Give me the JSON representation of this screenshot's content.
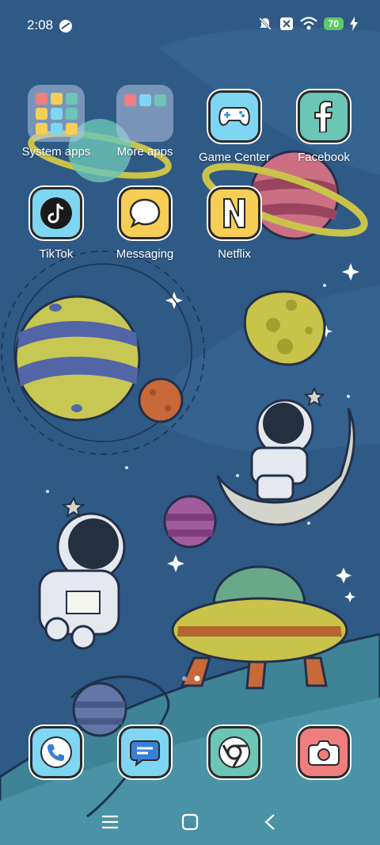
{
  "status_bar": {
    "time": "2:08",
    "battery_level": "70",
    "icons": [
      "vpn-icon",
      "mute-icon",
      "x-icon",
      "wifi-icon",
      "battery-icon",
      "charging-icon"
    ]
  },
  "home_apps": [
    {
      "label": "System apps",
      "type": "folder"
    },
    {
      "label": "More apps",
      "type": "folder"
    },
    {
      "label": "Game Center",
      "icon": "gamepad-icon"
    },
    {
      "label": "Facebook",
      "icon": "facebook-icon"
    },
    {
      "label": "TikTok",
      "icon": "tiktok-icon"
    },
    {
      "label": "Messaging",
      "icon": "message-bubble-icon"
    },
    {
      "label": "Netflix",
      "icon": "netflix-icon"
    }
  ],
  "dock": [
    {
      "name": "Phone",
      "icon": "phone-icon"
    },
    {
      "name": "Messages",
      "icon": "chat-icon"
    },
    {
      "name": "Chrome",
      "icon": "chrome-icon"
    },
    {
      "name": "Camera",
      "icon": "camera-icon"
    }
  ],
  "page_indicator": {
    "pages": 2,
    "current": 2
  },
  "colors": {
    "icon_blue": "#7fd6f2",
    "icon_yellow": "#f6cd55",
    "icon_teal": "#6cc6b6",
    "icon_coral": "#ef7f7e"
  }
}
